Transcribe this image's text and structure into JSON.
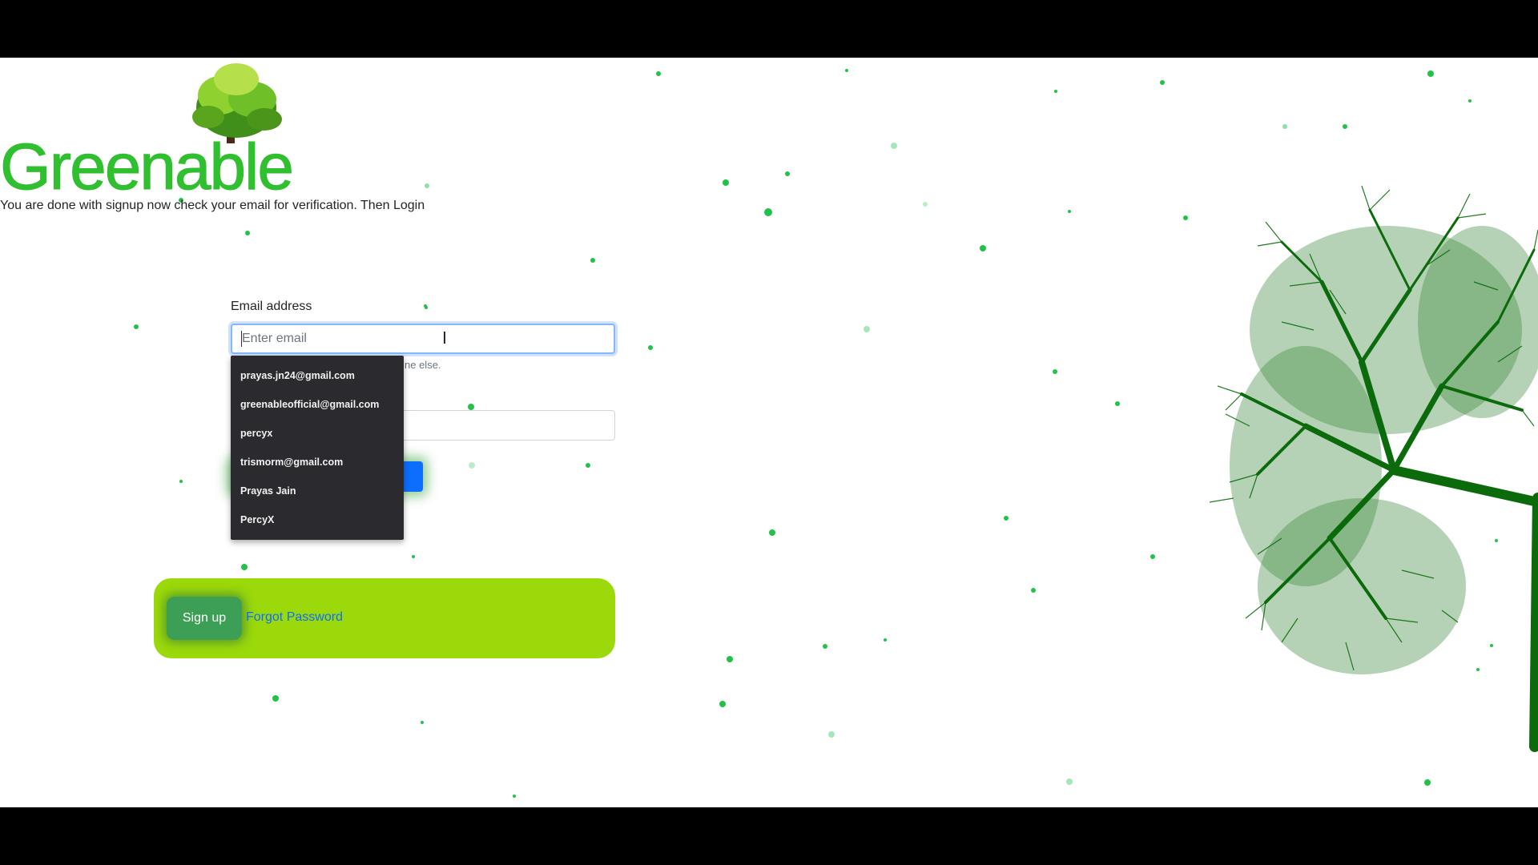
{
  "app": {
    "logo_text": "Greenable",
    "signup_message": "You are done with signup now check your email for verification. Then Login"
  },
  "form": {
    "email_label": "Email address",
    "email_placeholder": "Enter email",
    "email_help_fragment": "ne else."
  },
  "autocomplete": {
    "items": [
      "prayas.jn24@gmail.com",
      "greenableofficial@gmail.com",
      "percyx",
      "trismorm@gmail.com",
      "Prayas Jain",
      "PercyX"
    ]
  },
  "actions": {
    "signup_label": "Sign up",
    "forgot_label": "Forgot Password"
  },
  "colors": {
    "panel": "#9bd90a",
    "signup_button": "#3d9f55",
    "tree": "#0b6b0b",
    "particles": "#22c24a"
  }
}
